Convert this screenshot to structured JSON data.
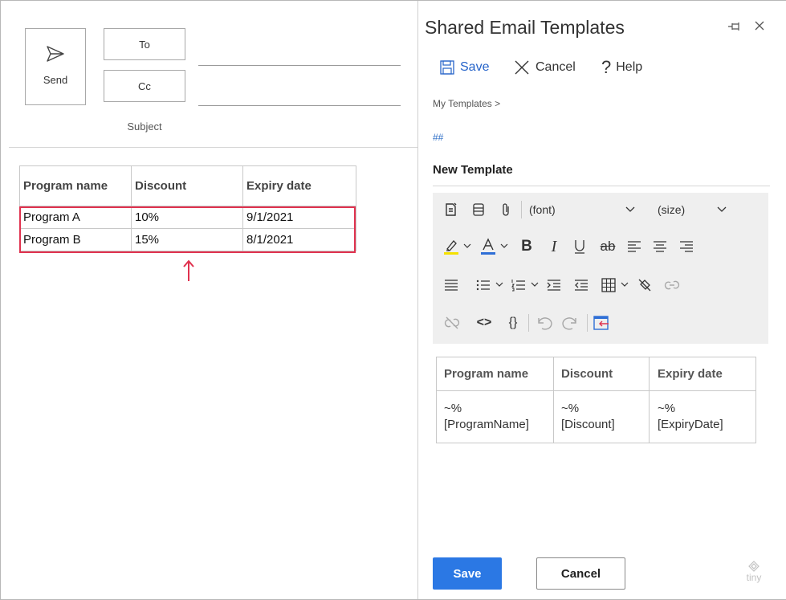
{
  "compose": {
    "send_label": "Send",
    "to_label": "To",
    "cc_label": "Cc",
    "subject_label": "Subject",
    "table": {
      "headers": [
        "Program name",
        "Discount",
        "Expiry date"
      ],
      "rows": [
        [
          "Program A",
          "10%",
          "9/1/2021"
        ],
        [
          "Program B",
          "15%",
          "8/1/2021"
        ]
      ]
    },
    "highlight_color": "#e0324f"
  },
  "panel": {
    "title": "Shared Email Templates",
    "toolbar": {
      "save": "Save",
      "cancel": "Cancel",
      "help": "Help"
    },
    "breadcrumb": "My Templates >",
    "hash": "##",
    "template_title": "New Template",
    "editor": {
      "font_select": "(font)",
      "size_select": "(size)",
      "icons": [
        "insert-template-icon",
        "align-block-icon",
        "attachment-icon",
        "highlight-icon",
        "font-color-icon",
        "bold-icon",
        "italic-icon",
        "underline-icon",
        "strikethrough-icon",
        "align-left-icon",
        "align-center-icon",
        "align-right-icon",
        "justify-icon",
        "bullet-list-icon",
        "numbered-list-icon",
        "indent-icon",
        "outdent-icon",
        "table-icon",
        "clear-format-icon",
        "link-icon",
        "unlink-icon",
        "source-code-icon",
        "braces-icon",
        "undo-icon",
        "redo-icon",
        "exit-icon"
      ],
      "accent": "#2b78e4"
    },
    "template_table": {
      "headers": [
        "Program name",
        "Discount",
        "Expiry date"
      ],
      "cells": [
        [
          "~%",
          "[ProgramName]"
        ],
        [
          "~%",
          "[Discount]"
        ],
        [
          "~%",
          "[ExpiryDate]"
        ]
      ]
    },
    "footer": {
      "save": "Save",
      "cancel": "Cancel",
      "logo_text": "tiny"
    }
  }
}
